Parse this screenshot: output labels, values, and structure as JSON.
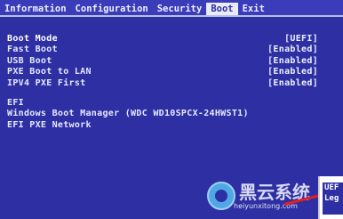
{
  "menu": {
    "tabs": [
      {
        "label": "Information"
      },
      {
        "label": "Configuration"
      },
      {
        "label": "Security"
      },
      {
        "label": "Boot"
      },
      {
        "label": "Exit"
      }
    ],
    "active_index": 3
  },
  "boot": {
    "items": [
      {
        "label": "Boot Mode",
        "value": "[UEFI]"
      },
      {
        "label": "Fast Boot",
        "value": "[Enabled]"
      },
      {
        "label": "USB Boot",
        "value": "[Enabled]"
      },
      {
        "label": "PXE Boot to LAN",
        "value": "[Enabled]"
      },
      {
        "label": "IPV4 PXE First",
        "value": "[Enabled]"
      }
    ],
    "efi_header": "EFI",
    "efi_items": [
      {
        "label": "Windows Boot Manager (WDC WD10SPCX-24HWST1)"
      },
      {
        "label": "EFI PXE Network"
      }
    ]
  },
  "side_panel": {
    "line1": "UEF",
    "line2": "Leg"
  },
  "watermark": {
    "title": "黑云系统",
    "url": "heiyunxitong.com"
  },
  "colors": {
    "background": "#2d2fa3",
    "menubar": "#3a3cba",
    "text": "#e6e8ff",
    "active_tab": "#e9ecf8"
  }
}
